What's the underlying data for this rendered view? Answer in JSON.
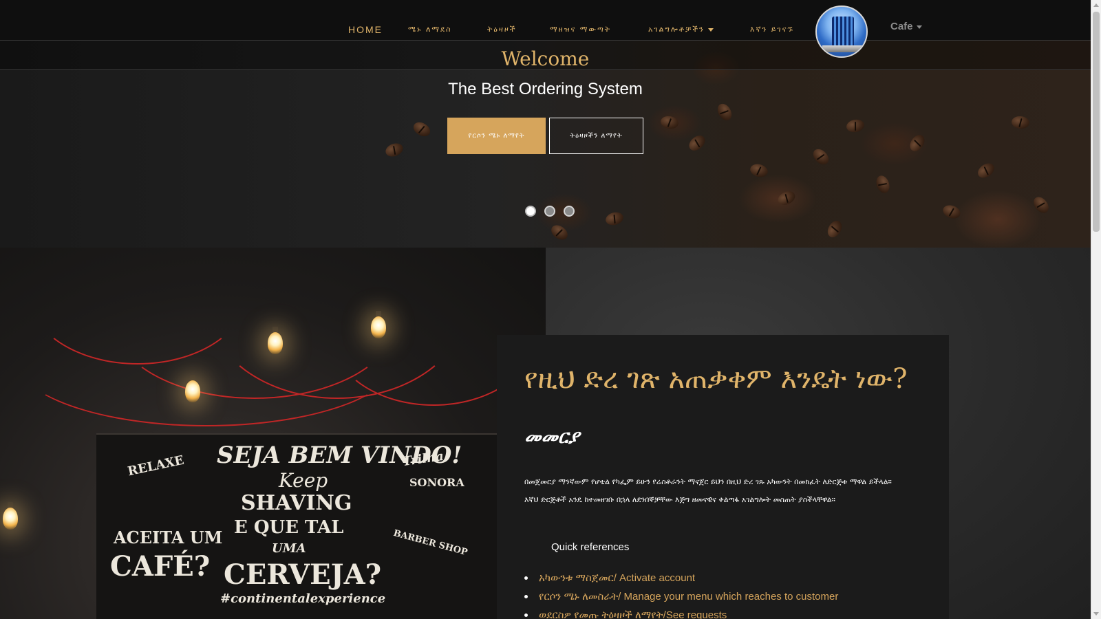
{
  "nav": {
    "items": [
      {
        "label": "HOME",
        "dropdown": false
      },
      {
        "label": "ሜኑ ለማደስ",
        "dropdown": false
      },
      {
        "label": "ትዕዛዞች",
        "dropdown": false
      },
      {
        "label": "ማዘዝና ማውጣት",
        "dropdown": false
      },
      {
        "label": "አገልግሎቶቻችን",
        "dropdown": true
      },
      {
        "label": "እኛን ይገናኙ",
        "dropdown": false
      }
    ],
    "cafe_label": "Cafe"
  },
  "hero": {
    "welcome": "Welcome",
    "subtitle": "The Best Ordering System",
    "primary_button": "የርሶን ሜኑ ለማየት",
    "secondary_button": "ትዕዛዞችን ለማየት",
    "slides": 3,
    "active_slide": 1
  },
  "chalkboard": {
    "lines": [
      "RELAXE",
      "SEJA BEM VINDO!",
      "Keep",
      "SHAVING",
      "E QUE TAL",
      "UMA",
      "ACEITA UM",
      "CAFÉ?",
      "CERVEJA?",
      "#continentalexperience",
      "BARBER SHOP",
      "SONORA",
      "Trilha"
    ]
  },
  "card": {
    "title": "የዚህ ድረ ገጽ አጠቃቀም እንዴት ነው?",
    "subtitle": "መመርያ",
    "body": "በመጀመርያ ማንኛውም የሆቴል የካፌም ይሁን የሬስቶራንት ማናጀር ይህን በዚህ ድረ ገጹ አካውንት በመክፈት ለድርጅቱ ማዋል ይችላል። እኛህ ድርጅቶች አንዴ ከተመዘገቡ በኋላ ለደንበኞቻቸው እጅግ ዘመናዊና ቀልጣፋ አገልግሎት መስጠት ያስችላቸዋል።",
    "quick_references": "Quick references",
    "links": [
      "አካውንቱ ማስጀመር/ Activate account",
      "የርሶን ሜኑ ለመስራት/ Manage your menu which reaches to customer",
      "ወደርስዎ የመጡ ትዕዛዞች ለማየት/See requests"
    ]
  },
  "colors": {
    "accent": "#e0b46a",
    "button": "#d6a55c",
    "navbar": "#0f0f0f"
  }
}
